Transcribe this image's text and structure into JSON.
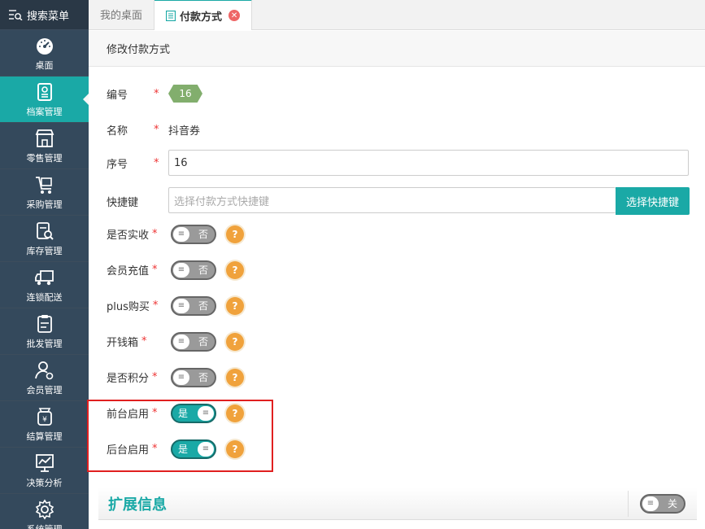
{
  "sidebar": {
    "search_label": "搜索菜单",
    "items": [
      {
        "label": "桌面",
        "icon": "dashboard-icon"
      },
      {
        "label": "档案管理",
        "icon": "archive-icon"
      },
      {
        "label": "零售管理",
        "icon": "store-icon"
      },
      {
        "label": "采购管理",
        "icon": "cart-icon"
      },
      {
        "label": "库存管理",
        "icon": "inventory-icon"
      },
      {
        "label": "连锁配送",
        "icon": "truck-icon"
      },
      {
        "label": "批发管理",
        "icon": "clipboard-icon"
      },
      {
        "label": "会员管理",
        "icon": "member-icon"
      },
      {
        "label": "结算管理",
        "icon": "settlement-icon"
      },
      {
        "label": "决策分析",
        "icon": "chart-icon"
      },
      {
        "label": "系统管理",
        "icon": "gear-icon"
      }
    ]
  },
  "tabs": [
    {
      "label": "我的桌面"
    },
    {
      "label": "付款方式"
    }
  ],
  "page": {
    "title": "修改付款方式"
  },
  "form": {
    "id_label": "编号",
    "id_value": "16",
    "name_label": "名称",
    "name_value": "抖音券",
    "seq_label": "序号",
    "seq_value": "16",
    "hotkey_label": "快捷键",
    "hotkey_placeholder": "选择付款方式快捷键",
    "hotkey_button": "选择快捷键",
    "required_mark": "*",
    "help_mark": "?",
    "switches": [
      {
        "label": "是否实收",
        "state": "否",
        "on": false
      },
      {
        "label": "会员充值",
        "state": "否",
        "on": false
      },
      {
        "label": "plus购买",
        "state": "否",
        "on": false
      },
      {
        "label": "开钱箱",
        "state": "否",
        "on": false
      },
      {
        "label": "是否积分",
        "state": "否",
        "on": false
      },
      {
        "label": "前台启用",
        "state": "是",
        "on": true
      },
      {
        "label": "后台启用",
        "state": "是",
        "on": true
      }
    ]
  },
  "extension": {
    "title": "扩展信息",
    "toggle_state": "关"
  },
  "colors": {
    "accent": "#1aa9a6",
    "sidebar": "#34495c",
    "badge": "#82ae6d",
    "help": "#f0a23c",
    "highlight": "#e02020"
  }
}
